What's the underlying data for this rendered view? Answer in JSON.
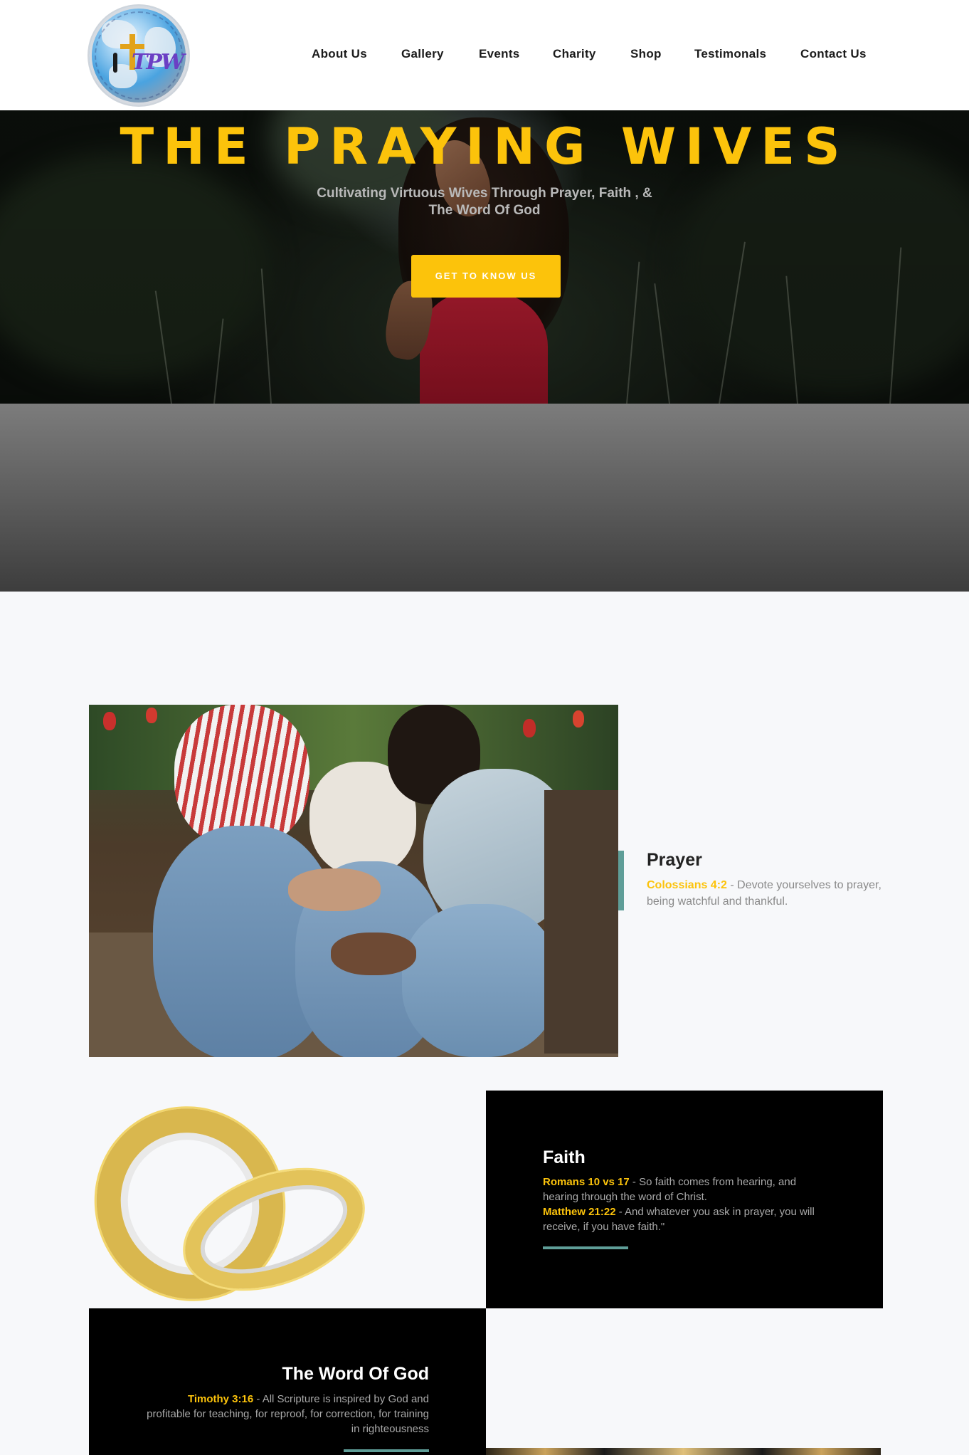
{
  "header": {
    "logo_text": "TPW",
    "nav": [
      {
        "label": "About Us"
      },
      {
        "label": "Gallery"
      },
      {
        "label": "Events"
      },
      {
        "label": "Charity"
      },
      {
        "label": "Shop"
      },
      {
        "label": "Testimonals"
      },
      {
        "label": "Contact Us"
      }
    ]
  },
  "hero": {
    "title": "THE PRAYING WIVES",
    "subtitle": "Cultivating Virtuous Wives Through Prayer, Faith , & The Word Of God",
    "cta": "GET TO KNOW US"
  },
  "prayer": {
    "title": "Prayer",
    "ref": "Colossians 4:2",
    "text": " - Devote yourselves to prayer, being watchful and thankful."
  },
  "faith": {
    "title": "Faith",
    "ref1": "Romans 10 vs 17",
    "text1": " - So faith comes from hearing, and hearing through the word of Christ.",
    "ref2": "Matthew 21:22",
    "text2": " - And whatever you ask in prayer, you will receive, if you have faith.\""
  },
  "word": {
    "title": "The Word Of God",
    "ref": "Timothy 3:16",
    "text": " - All Scripture is inspired by God and profitable for teaching, for reproof, for correction, for training in righteousness"
  },
  "colors": {
    "accent_yellow": "#fcc30b",
    "accent_teal": "#5f9e98",
    "dark": "#000000"
  }
}
